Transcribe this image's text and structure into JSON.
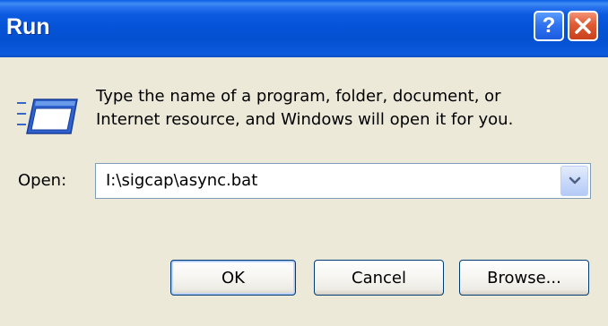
{
  "window": {
    "title": "Run",
    "help_glyph": "?",
    "help_icon": "question-mark-icon",
    "close_icon": "close-x-icon"
  },
  "dialog": {
    "icon": "run-program-icon",
    "description_line1": "Type the name of a program, folder, document, or",
    "description_line2": "Internet resource, and Windows will open it for you.",
    "open_label": "Open:",
    "open_value": "I:\\sigcap\\async.bat",
    "dropdown_icon": "chevron-down-icon"
  },
  "buttons": {
    "ok": "OK",
    "cancel": "Cancel",
    "browse": "Browse..."
  },
  "colors": {
    "titlebar_blue": "#0553d7",
    "close_red": "#e05a33",
    "dialog_bg": "#ece9d8"
  }
}
